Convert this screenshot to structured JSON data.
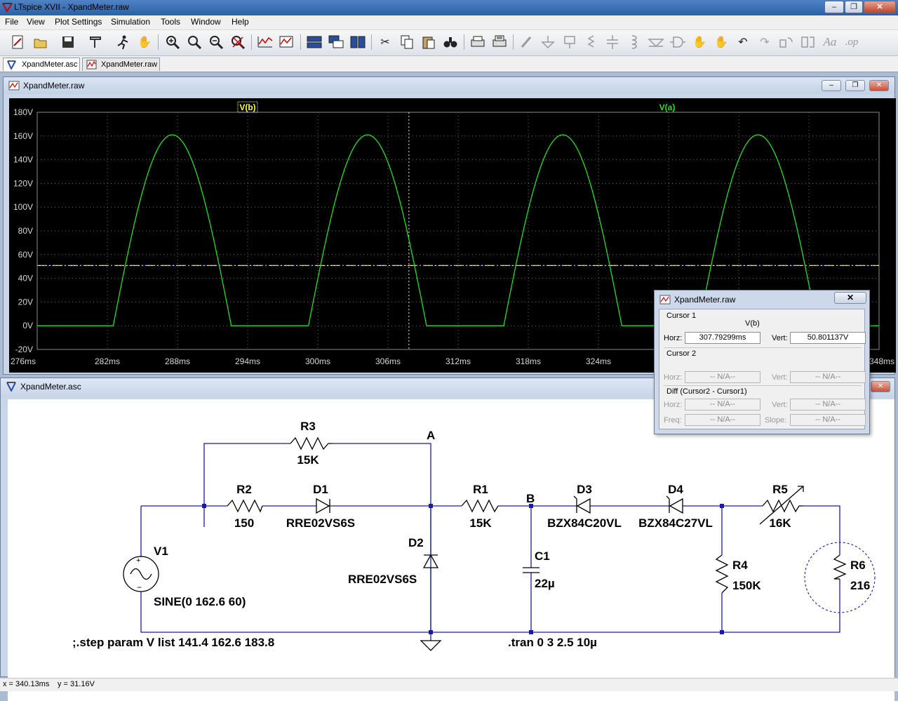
{
  "app": {
    "title": "LTspice XVII - XpandMeter.raw"
  },
  "window_controls": {
    "minimize": "–",
    "restore": "❐",
    "close": "✕"
  },
  "menu": [
    "File",
    "View",
    "Plot Settings",
    "Simulation",
    "Tools",
    "Window",
    "Help"
  ],
  "toolbar": {
    "icons": [
      "new-schematic-icon",
      "open-icon",
      "save-icon",
      "control-panel-icon",
      "run-icon",
      "pan-hand-icon",
      "zoom-in-icon",
      "zoom-rect-icon",
      "zoom-out-icon",
      "zoom-cancel-icon",
      "autorange-icon",
      "plot-settings-icon",
      "tile-horizontal-icon",
      "cascade-icon",
      "tile-vertical-icon",
      "cut-icon",
      "copy-icon",
      "paste-icon",
      "find-icon",
      "print-icon",
      "print-setup-icon",
      "wire-icon",
      "ground-icon",
      "label-net-icon",
      "resistor-icon",
      "capacitor-icon",
      "inductor-icon",
      "diode-icon",
      "component-icon",
      "move-icon",
      "drag-icon",
      "undo-icon",
      "redo-icon",
      "rotate-icon",
      "mirror-icon",
      "text-icon",
      "spice-directive-icon"
    ]
  },
  "tabs": [
    {
      "label": "XpandMeter.asc",
      "icon": "schematic-icon",
      "active": true
    },
    {
      "label": "XpandMeter.raw",
      "icon": "waveform-icon",
      "active": false
    }
  ],
  "plot_window": {
    "title": "XpandMeter.raw",
    "trace_labels": [
      "V(b)",
      "V(a)"
    ],
    "trace_colors": {
      "V(b)": "#ffff40",
      "V(a)": "#20e020"
    },
    "x_ticks": [
      "276ms",
      "282ms",
      "288ms",
      "294ms",
      "300ms",
      "306ms",
      "312ms",
      "318ms",
      "324ms",
      "330ms",
      "336ms",
      "342ms",
      "348ms"
    ],
    "y_ticks": [
      "180V",
      "160V",
      "140V",
      "120V",
      "100V",
      "80V",
      "60V",
      "40V",
      "20V",
      "0V",
      "-20V"
    ]
  },
  "chart_data": {
    "type": "line",
    "xunit": "ms",
    "yunit": "V",
    "xlim": [
      276,
      348
    ],
    "ylim": [
      -20,
      180
    ],
    "series": [
      {
        "name": "V(a)",
        "description_note": "",
        "peak": 161,
        "period_ms": 16.667,
        "peak_times_ms": [
          288.0,
          304.5,
          321.2,
          337.9
        ],
        "rise_start_ms": [
          282.5,
          299.2,
          315.9,
          332.6
        ],
        "fall_end_ms": [
          292.6,
          309.3,
          326.0,
          342.7
        ],
        "floor": 0
      },
      {
        "name": "V(b)",
        "level": 50.8
      }
    ],
    "cursor_x_ms": 307.79299
  },
  "cursor_dialog": {
    "title": "XpandMeter.raw",
    "cursor1_label": "Cursor 1",
    "cursor1_trace": "V(b)",
    "horz_label": "Horz:",
    "vert_label": "Vert:",
    "cursor1_horz": "307.79299ms",
    "cursor1_vert": "50.801137V",
    "cursor2_label": "Cursor 2",
    "cursor2_horz": "-- N/A--",
    "cursor2_vert": "-- N/A--",
    "diff_label": "Diff (Cursor2 - Cursor1)",
    "freq_label": "Freq:",
    "slope_label": "Slope:",
    "diff_horz": "-- N/A--",
    "diff_vert": "-- N/A--",
    "diff_freq": "-- N/A--",
    "diff_slope": "-- N/A--",
    "close": "✕"
  },
  "schematic_window": {
    "title": "XpandMeter.asc",
    "components": {
      "R3": {
        "name": "R3",
        "value": "15K"
      },
      "R2": {
        "name": "R2",
        "value": "150"
      },
      "D1": {
        "name": "D1",
        "value": "RRE02VS6S"
      },
      "R1": {
        "name": "R1",
        "value": "15K"
      },
      "D3": {
        "name": "D3",
        "value": "BZX84C20VL"
      },
      "D4": {
        "name": "D4",
        "value": "BZX84C27VL"
      },
      "R5": {
        "name": "R5",
        "value": "16K"
      },
      "V1": {
        "name": "V1",
        "value": "SINE(0 162.6 60)"
      },
      "D2": {
        "name": "D2",
        "value": "RRE02VS6S"
      },
      "C1": {
        "name": "C1",
        "value": "22µ"
      },
      "R4": {
        "name": "R4",
        "value": "150K"
      },
      "R6": {
        "name": "R6",
        "value": "216"
      }
    },
    "net_labels": {
      "A": "A",
      "B": "B"
    },
    "directives": {
      "step": ";.step param V list 141.4 162.6 183.8",
      "tran": ".tran 0 3 2.5 10µ"
    }
  },
  "status": {
    "x": "x = 340.13ms",
    "y": "y = 31.16V"
  }
}
